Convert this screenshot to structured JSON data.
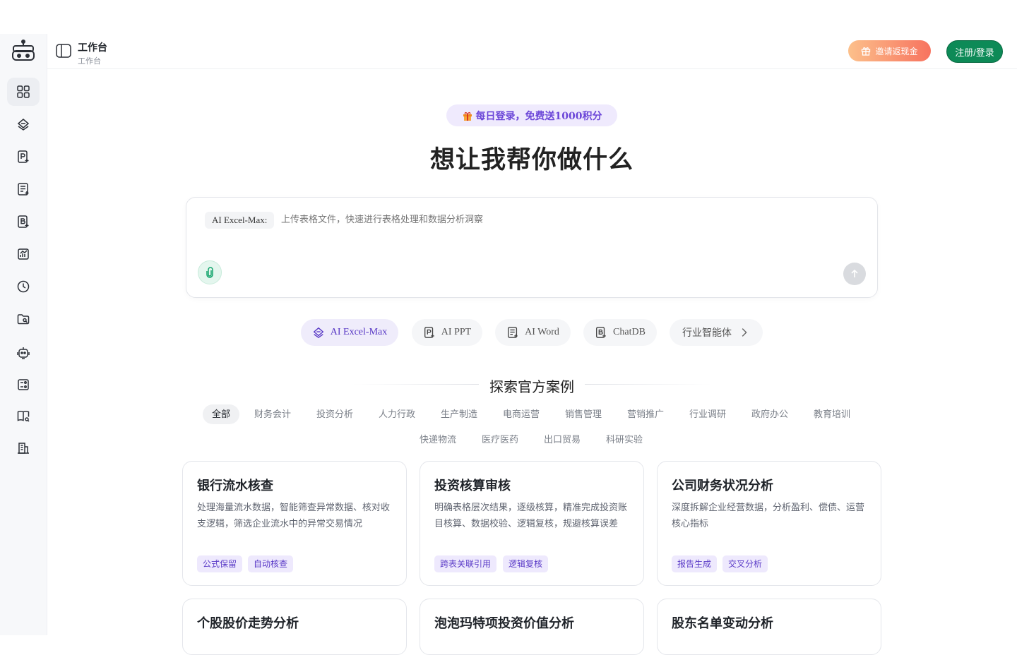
{
  "header": {
    "title": "工作台",
    "subtitle": "工作台",
    "invite_label": "邀请返现金",
    "login_label": "注册/登录"
  },
  "sidebar": {
    "icons": [
      "grid-icon",
      "excel-icon",
      "ppt-icon",
      "word-icon",
      "chatdb-icon",
      "chart-icon",
      "history-icon",
      "folder-icon",
      "robot-icon",
      "form-icon",
      "book-icon",
      "building-icon"
    ]
  },
  "hero": {
    "promo": "每日登录，免费送1000积分",
    "title": "想让我帮你做什么",
    "mode_label": "AI Excel-Max:",
    "placeholder": "上传表格文件，快速进行表格处理和数据分析洞察"
  },
  "tools": [
    {
      "label": "AI Excel-Max",
      "icon": "excel-icon",
      "active": true
    },
    {
      "label": "AI PPT",
      "icon": "ppt-icon"
    },
    {
      "label": "AI Word",
      "icon": "word-icon"
    },
    {
      "label": "ChatDB",
      "icon": "chatdb-icon"
    },
    {
      "label": "行业智能体",
      "icon": "chevron-right-icon"
    }
  ],
  "explore": {
    "title": "探索官方案例",
    "categories_row1": [
      "全部",
      "财务会计",
      "投资分析",
      "人力行政",
      "生产制造",
      "电商运营",
      "销售管理",
      "营销推广",
      "行业调研",
      "政府办公",
      "教育培训"
    ],
    "categories_row2": [
      "快递物流",
      "医疗医药",
      "出口贸易",
      "科研实验"
    ],
    "active_category": "全部"
  },
  "cards": [
    {
      "title": "银行流水核查",
      "desc": "处理海量流水数据，智能筛查异常数据、核对收支逻辑，筛选企业流水中的异常交易情况",
      "tags": [
        "公式保留",
        "自动核查"
      ]
    },
    {
      "title": "投资核算审核",
      "desc": "明确表格层次结果，逐级核算，精准完成投资账目核算、数据校验、逻辑复核，规避核算误差",
      "tags": [
        "跨表关联引用",
        "逻辑复核"
      ]
    },
    {
      "title": "公司财务状况分析",
      "desc": "深度拆解企业经营数据，分析盈利、偿债、运营核心指标",
      "tags": [
        "报告生成",
        "交叉分析"
      ]
    },
    {
      "title": "个股股价走势分析"
    },
    {
      "title": "泡泡玛特项投资价值分析"
    },
    {
      "title": "股东名单变动分析"
    }
  ],
  "colors": {
    "accent": "#5535c4",
    "brand_green": "#0d8a57",
    "invite_gradient_start": "#fcc08b",
    "invite_gradient_end": "#f7735f"
  }
}
